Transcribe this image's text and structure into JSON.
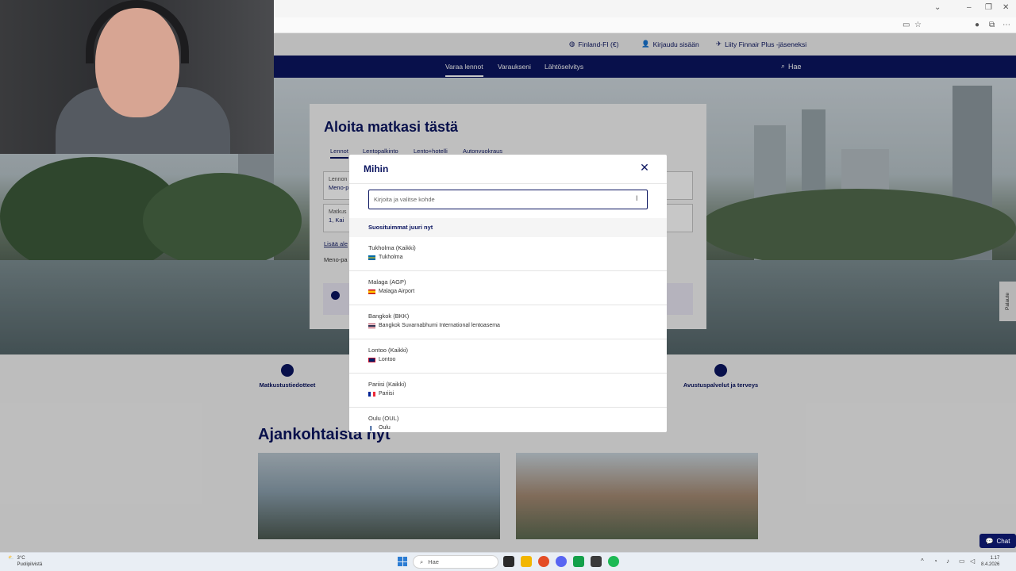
{
  "site_header": {
    "locale": "Finland-FI (€)",
    "login": "Kirjaudu sisään",
    "join": "Liity Finnair Plus -jäseneksi"
  },
  "nav": {
    "items": [
      "Varaa lennot",
      "Varaukseni",
      "Lähtöselvitys"
    ],
    "search": "Hae"
  },
  "booking": {
    "title": "Aloita matkasi tästä",
    "tabs": [
      "Lennot",
      "Lentopalkinto",
      "Lento+hotelli",
      "Autonvuokraus"
    ],
    "field_from_label": "Lennon",
    "field_from_value": "Meno-p",
    "field_pax_label": "Matkus",
    "field_pax_value": "1, Kai",
    "link_more": "Lisää ale",
    "label_trip": "Meno-pa"
  },
  "feedback": "Palaute",
  "modal": {
    "title": "Mihin",
    "placeholder": "Kirjoita ja valitse kohde",
    "popular_heading": "Suosituimmat juuri nyt",
    "destinations": [
      {
        "name": "Tukholma (Kaikki)",
        "detail": "Tukholma",
        "flag": "se"
      },
      {
        "name": "Malaga (AGP)",
        "detail": "Malaga Airport",
        "flag": "es"
      },
      {
        "name": "Bangkok (BKK)",
        "detail": "Bangkok Suvarnabhumi International lentoasema",
        "flag": "th"
      },
      {
        "name": "Lontoo (Kaikki)",
        "detail": "Lontoo",
        "flag": "gb"
      },
      {
        "name": "Pariisi (Kaikki)",
        "detail": "Pariisi",
        "flag": "fr"
      },
      {
        "name": "Oulu (OUL)",
        "detail": "Oulu",
        "flag": "fi"
      }
    ]
  },
  "services": {
    "left": "Matkustustiedotteet",
    "right": "Avustuspalvelut ja terveys"
  },
  "section_title": "Ajankohtaista nyt",
  "chat": "Chat",
  "taskbar": {
    "weather_temp": "3°C",
    "weather_text": "Puolipilvistä",
    "search": "Hae",
    "time": "1.17",
    "date": "8.4.2026"
  },
  "colors": {
    "brand_navy": "#0b1560",
    "overlay": "rgba(0,0,0,0.22)"
  }
}
